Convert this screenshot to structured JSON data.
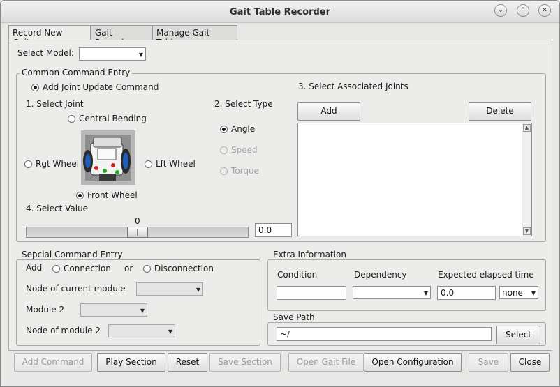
{
  "window": {
    "title": "Gait Table Recorder",
    "controls": {
      "minimize": "⌄",
      "maximize": "⌃",
      "close": "✕"
    }
  },
  "tabs": [
    {
      "label": "Record New Gaits",
      "active": true
    },
    {
      "label": "Gait Records",
      "active": false
    },
    {
      "label": "Manage Gait Table",
      "active": false
    }
  ],
  "model": {
    "label": "Select Model:",
    "value": ""
  },
  "common": {
    "title": "Common Command Entry",
    "add_joint_label": "Add Joint Update Command",
    "select_joint_label": "1. Select Joint",
    "joints": {
      "central": "Central Bending",
      "rgt": "Rgt Wheel",
      "lft": "Lft Wheel",
      "front": "Front Wheel"
    },
    "selected_joint": "front",
    "select_type_label": "2. Select Type",
    "types": {
      "angle": "Angle",
      "speed": "Speed",
      "torque": "Torque"
    },
    "selected_type": "angle",
    "select_value_label": "4. Select Value",
    "slider_value": "0",
    "value_field": "0.0",
    "associated_label": "3. Select Associated Joints",
    "add_button": "Add",
    "delete_button": "Delete"
  },
  "special": {
    "title": "Sepcial Command Entry",
    "add_label": "Add",
    "connection_label": "Connection",
    "or_label": "or",
    "disconnection_label": "Disconnection",
    "node_current_label": "Node of current module",
    "module2_label": "Module 2",
    "node_module2_label": "Node of module 2"
  },
  "extra": {
    "title": "Extra Information",
    "condition_label": "Condition",
    "dependency_label": "Dependency",
    "elapsed_label": "Expected elapsed time",
    "condition_value": "",
    "elapsed_value": "0.0",
    "unit_value": "none"
  },
  "save_path": {
    "title": "Save Path",
    "value": "~/",
    "select_button": "Select"
  },
  "bottom_buttons": {
    "add_command": "Add Command",
    "play_section": "Play Section",
    "reset": "Reset",
    "save_section": "Save Section",
    "open_gait_file": "Open Gait File",
    "open_configuration": "Open Configuration",
    "save": "Save",
    "close": "Close"
  }
}
